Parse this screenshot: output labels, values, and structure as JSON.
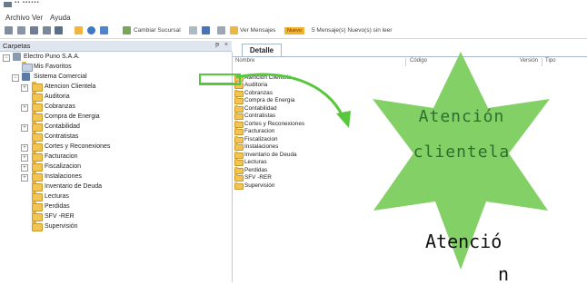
{
  "window": {
    "title": "▪▪ ▪▪▪▪▪▪"
  },
  "menu": {
    "items": [
      "Archivo",
      "Ver",
      "Ayuda"
    ]
  },
  "toolbar": {
    "cambiar_sucursal": "Cambiar Sucursal",
    "ver_mensajes": "Ver Mensajes",
    "nuevo_badge": "Nuevo",
    "mensajes_status": "5 Mensaje(s) Nuevo(s) sin leer"
  },
  "carpetas": {
    "title": "Carpetas",
    "pin": "ᵽ",
    "close": "×"
  },
  "tree": {
    "root": "Electro Puno S.A.A.",
    "favoritos": "Mis Favoritos",
    "sistema": "Sistema Comercial",
    "items": [
      "Atencion Clientela",
      "Auditoria",
      "Cobranzas",
      "Compra de Energia",
      "Contabilidad",
      "Contratistas",
      "Cortes y Reconexiones",
      "Facturacion",
      "Fiscalizacion",
      "Instalaciones",
      "Inventario de Deuda",
      "Lecturas",
      "Perdidas",
      "SFV -RER",
      "Supervisión"
    ]
  },
  "detalle": {
    "tab": "Detalle",
    "columns": [
      "Nombre",
      "Código",
      "Versión",
      "Tipo"
    ],
    "rows": [
      "Atencion Clientela",
      "Auditoria",
      "Cobranzas",
      "Compra de Energia",
      "Contabilidad",
      "Contratistas",
      "Cortes y Reconexiones",
      "Facturacion",
      "Fiscalizacion",
      "Instalaciones",
      "Inventario de Deuda",
      "Lecturas",
      "Perdidas",
      "SFV -RER",
      "Supervisión"
    ]
  },
  "callout": {
    "star_line1": "Atención",
    "star_line2": "clientela",
    "big_line1": "Atenció",
    "big_line2": "n"
  },
  "colors": {
    "star": "#82d066",
    "highlight": "#57c73c",
    "folder": "#f1c453",
    "badge": "#f2b22c"
  }
}
